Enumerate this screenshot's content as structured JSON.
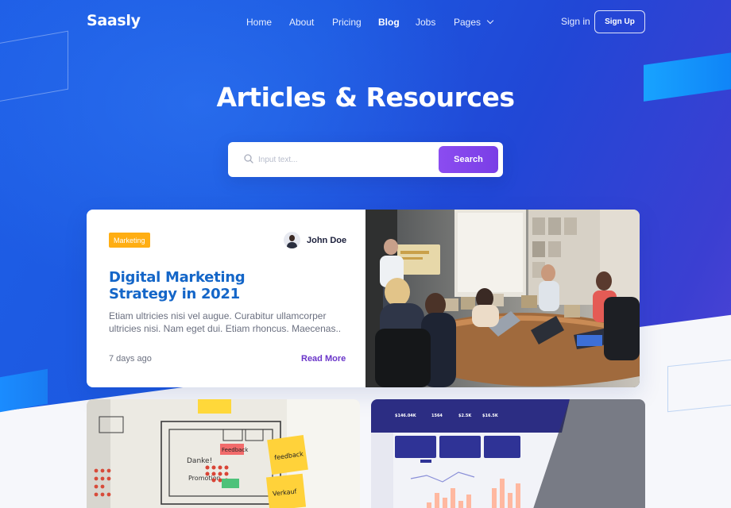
{
  "nav": {
    "logo": "Saasly",
    "items": [
      {
        "label": "Home"
      },
      {
        "label": "About"
      },
      {
        "label": "Pricing"
      },
      {
        "label": "Blog"
      },
      {
        "label": "Jobs"
      },
      {
        "label": "Pages"
      }
    ],
    "sign_in": "Sign in",
    "sign_up": "Sign Up"
  },
  "hero": {
    "title": "Articles & Resources"
  },
  "search": {
    "placeholder": "Input text...",
    "button": "Search"
  },
  "featured": {
    "category": "Marketing",
    "author": "John Doe",
    "title": "Digital Marketing Strategy in 2021",
    "excerpt": "Etiam ultricies nisi vel augue. Curabitur ullamcorper ultricies nisi. Nam eget dui. Etiam rhoncus. Maecenas..",
    "time": "7 days ago",
    "read_more": "Read More"
  },
  "sticky_notes": {
    "note1": "Danke!",
    "note2": "Feedback",
    "note3": "feedback",
    "note4": "Verkauf",
    "note5": "Promotion"
  },
  "dashboard": {
    "stat1": "$146.04K",
    "stat2": "1564",
    "stat3": "$2.5K",
    "stat4": "$16.5K"
  },
  "colors": {
    "brand_blue": "#1e5ee6",
    "accent_purple": "#7a3ee6",
    "badge_orange": "#ffae13",
    "title_blue": "#1466c8"
  }
}
